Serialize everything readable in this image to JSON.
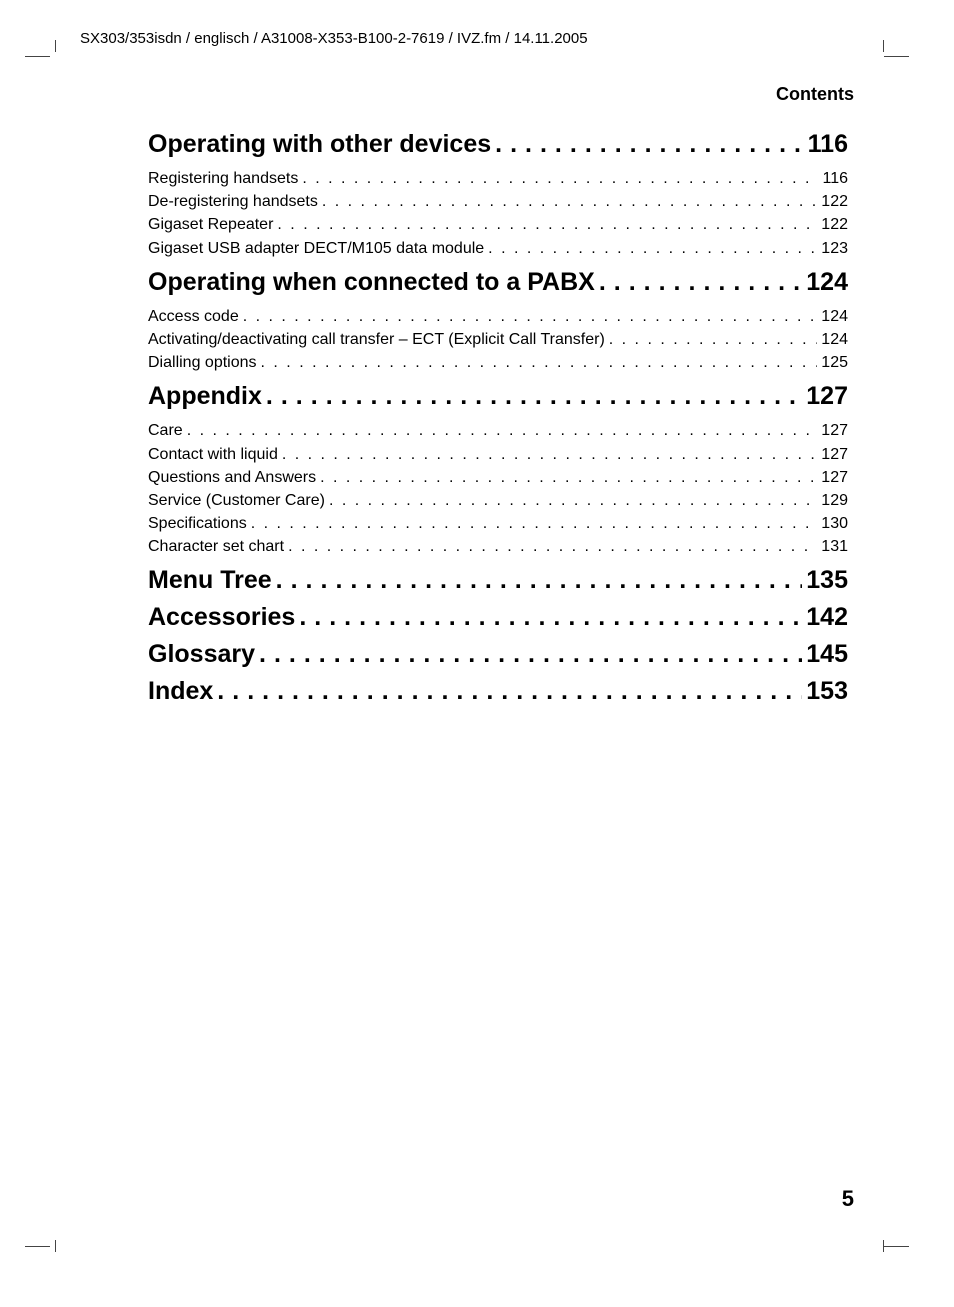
{
  "header_path": "SX303/353isdn / englisch / A31008-X353-B100-2-7619 / IVZ.fm / 14.11.2005",
  "contents_label": "Contents",
  "page_number": "5",
  "sections": [
    {
      "title": "Operating with other devices",
      "page": "116",
      "entries": [
        {
          "title": "Registering handsets",
          "page": "116"
        },
        {
          "title": "De-registering handsets",
          "page": "122"
        },
        {
          "title": "Gigaset Repeater",
          "page": "122"
        },
        {
          "title": "Gigaset USB adapter DECT/M105 data module",
          "page": "123"
        }
      ]
    },
    {
      "title": "Operating when connected to a PABX",
      "page": "124",
      "entries": [
        {
          "title": "Access code",
          "page": "124"
        },
        {
          "title": "Activating/deactivating call transfer – ECT (Explicit Call Transfer)",
          "page": "124"
        },
        {
          "title": "Dialling options",
          "page": "125"
        }
      ]
    },
    {
      "title": "Appendix",
      "page": "127",
      "entries": [
        {
          "title": "Care",
          "page": "127"
        },
        {
          "title": "Contact with liquid",
          "page": "127"
        },
        {
          "title": "Questions and Answers",
          "page": "127"
        },
        {
          "title": "Service (Customer Care)",
          "page": "129"
        },
        {
          "title": "Specifications",
          "page": "130"
        },
        {
          "title": "Character set chart",
          "page": "131"
        }
      ]
    },
    {
      "title": "Menu Tree",
      "page": "135",
      "entries": []
    },
    {
      "title": "Accessories",
      "page": "142",
      "entries": []
    },
    {
      "title": "Glossary",
      "page": "145",
      "entries": []
    },
    {
      "title": "Index",
      "page": "153",
      "entries": []
    }
  ]
}
